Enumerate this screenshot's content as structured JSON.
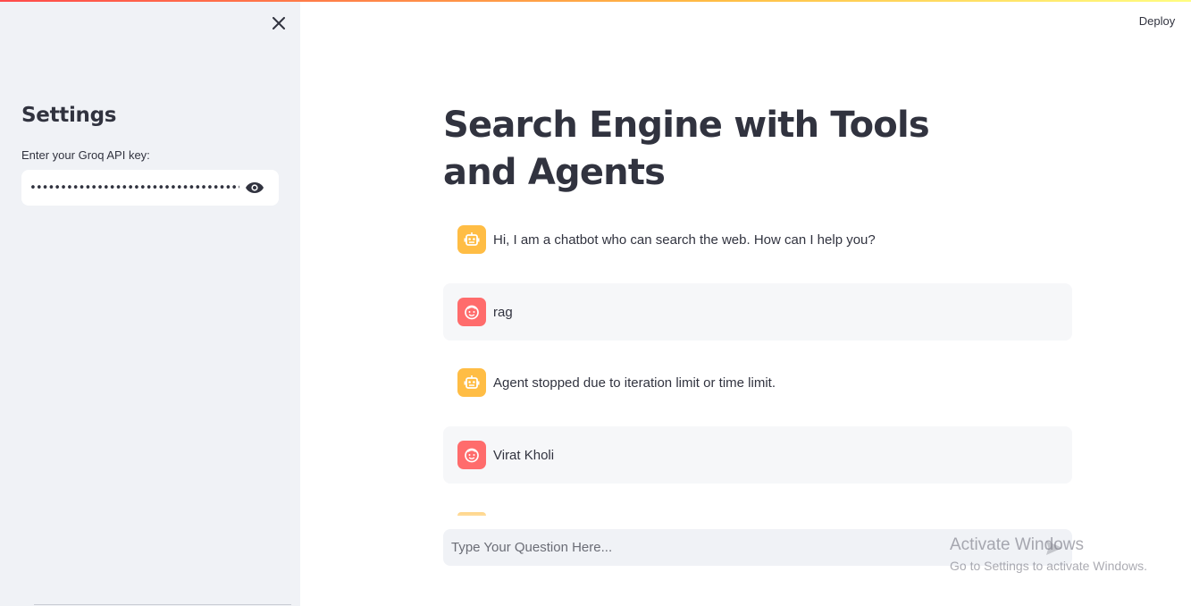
{
  "header": {
    "deploy_label": "Deploy"
  },
  "sidebar": {
    "title": "Settings",
    "api_key_label": "Enter your Groq API key:",
    "api_key_value": "•••••••••••••••••••••••••••••••••••••••••••••••••••••",
    "close_icon": "close-icon",
    "visibility_icon": "eye-icon"
  },
  "main": {
    "title": "Search Engine with Tools and Agents",
    "messages": [
      {
        "role": "assistant",
        "text": "Hi, I am a chatbot who can search the web. How can I help you?"
      },
      {
        "role": "user",
        "text": "rag"
      },
      {
        "role": "assistant",
        "text": "Agent stopped due to iteration limit or time limit."
      },
      {
        "role": "user",
        "text": "Virat Kholi"
      }
    ],
    "chat_input": {
      "placeholder": "Type Your Question Here...",
      "value": ""
    }
  },
  "watermark": {
    "title": "Activate Windows",
    "subtitle": "Go to Settings to activate Windows."
  },
  "colors": {
    "accent_red": "#ff4b4b",
    "assistant_avatar": "#ffbd45",
    "user_avatar": "#ff6c6c",
    "sidebar_bg": "#f0f2f6"
  }
}
